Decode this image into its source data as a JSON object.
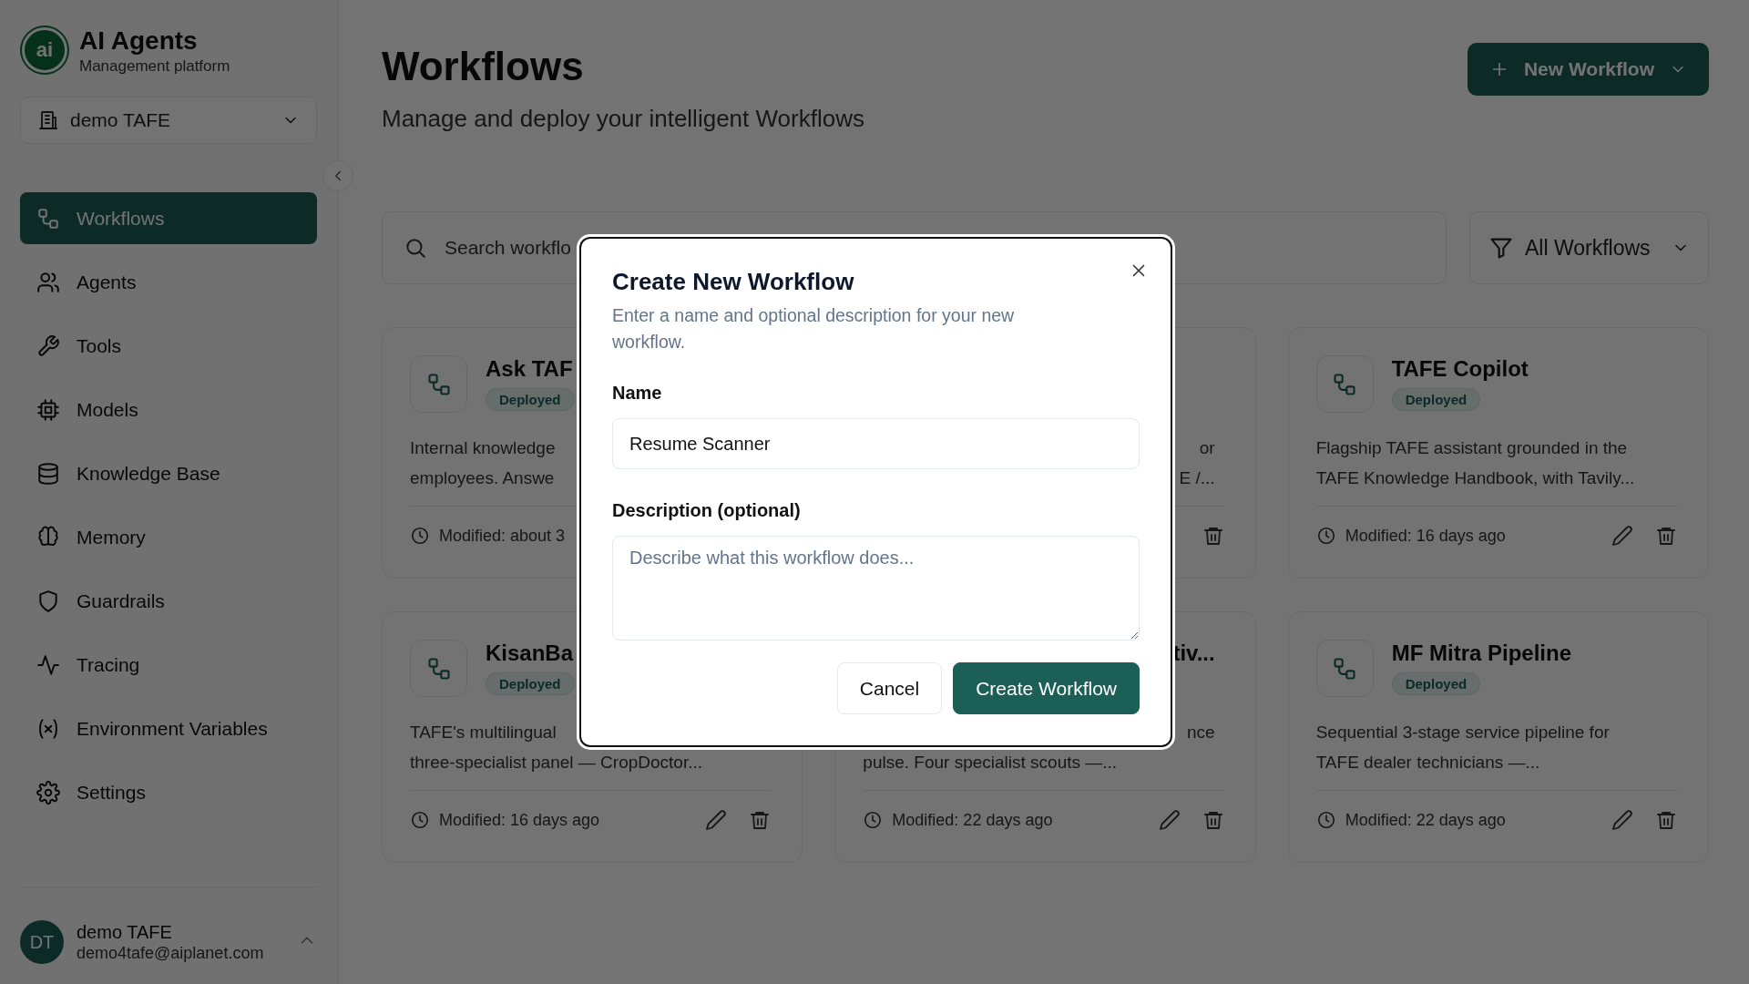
{
  "app": {
    "logo_text": "ai",
    "name": "AI Agents",
    "tagline": "Management platform"
  },
  "org_selector": {
    "label": "demo TAFE"
  },
  "nav": [
    {
      "label": "Workflows",
      "selected": true
    },
    {
      "label": "Agents",
      "selected": false
    },
    {
      "label": "Tools",
      "selected": false
    },
    {
      "label": "Models",
      "selected": false
    },
    {
      "label": "Knowledge Base",
      "selected": false
    },
    {
      "label": "Memory",
      "selected": false
    },
    {
      "label": "Guardrails",
      "selected": false
    },
    {
      "label": "Tracing",
      "selected": false
    },
    {
      "label": "Environment Variables",
      "selected": false
    },
    {
      "label": "Settings",
      "selected": false
    }
  ],
  "user": {
    "initials": "DT",
    "name": "demo TAFE",
    "email": "demo4tafe@aiplanet.com"
  },
  "header": {
    "title": "Workflows",
    "subtitle": "Manage and deploy your intelligent Workflows",
    "new_button": "New Workflow"
  },
  "search": {
    "placeholder": "Search workflo"
  },
  "filter": {
    "label": "All Workflows"
  },
  "cards": [
    {
      "title": "Ask TAF",
      "status": "Deployed",
      "lines": [
        {
          "text": "Internal knowledge",
          "kind": "line"
        },
        {
          "text": "employees. Answe",
          "kind": "line"
        }
      ],
      "modified": "Modified: about 3"
    },
    {
      "lines": [
        {
          "text": "or",
          "kind": "tail"
        },
        {
          "text": "E /...",
          "kind": "tail"
        }
      ],
      "actions": [
        {
          "kind": "delete"
        }
      ]
    },
    {
      "title": "TAFE Copilot",
      "status": "Deployed",
      "lines": [
        {
          "text": "Flagship TAFE assistant grounded in the",
          "kind": "line"
        },
        {
          "text": "TAFE Knowledge Handbook, with Tavily...",
          "kind": "line"
        }
      ],
      "modified": "Modified: 16 days ago",
      "actions": [
        {
          "kind": "edit"
        },
        {
          "kind": "delete"
        }
      ]
    },
    {
      "title": "KisanBa",
      "status": "Deployed",
      "lines": [
        {
          "text": "TAFE's multilingual",
          "kind": "line"
        },
        {
          "text": "three-specialist panel — CropDoctor...",
          "kind": "line"
        }
      ],
      "modified": "Modified: 16 days ago",
      "actions": [
        {
          "kind": "edit"
        },
        {
          "kind": "delete"
        }
      ]
    },
    {
      "title": "tiv...",
      "lines": [
        {
          "text": "nce",
          "kind": "tail"
        },
        {
          "text": "pulse. Four specialist scouts —...",
          "kind": "line"
        }
      ],
      "modified": "Modified: 22 days ago",
      "actions": [
        {
          "kind": "edit"
        },
        {
          "kind": "delete"
        }
      ]
    },
    {
      "title": "MF Mitra Pipeline",
      "status": "Deployed",
      "lines": [
        {
          "text": "Sequential 3-stage service pipeline for",
          "kind": "line"
        },
        {
          "text": "TAFE dealer technicians —...",
          "kind": "line"
        }
      ],
      "modified": "Modified: 22 days ago",
      "actions": [
        {
          "kind": "edit"
        },
        {
          "kind": "delete"
        }
      ]
    }
  ],
  "dialog": {
    "title": "Create New Workflow",
    "description": "Enter a name and optional description for your new workflow.",
    "name_label": "Name",
    "name_value": "Resume Scanner",
    "description_label": "Description (optional)",
    "description_placeholder": "Describe what this workflow does...",
    "buttons": [
      {
        "label": "Cancel",
        "kind": "secondary"
      },
      {
        "label": "Create Workflow",
        "kind": "primary"
      }
    ]
  }
}
